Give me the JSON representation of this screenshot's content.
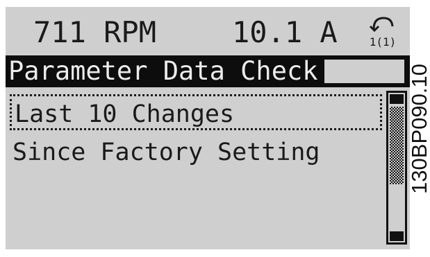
{
  "status": {
    "speed": "711 RPM",
    "current": "10.1 A"
  },
  "menu_indicator": "1(1)",
  "title": "Parameter Data Check",
  "items": [
    {
      "label": "Last 10 Changes",
      "selected": true
    },
    {
      "label": "Since Factory Setting",
      "selected": false
    }
  ],
  "side_label": "130BP090.10",
  "colors": {
    "lcd_background": "#cfcfcf",
    "lcd_text": "#1a1a1a",
    "title_bar": "#0d0d0d"
  }
}
